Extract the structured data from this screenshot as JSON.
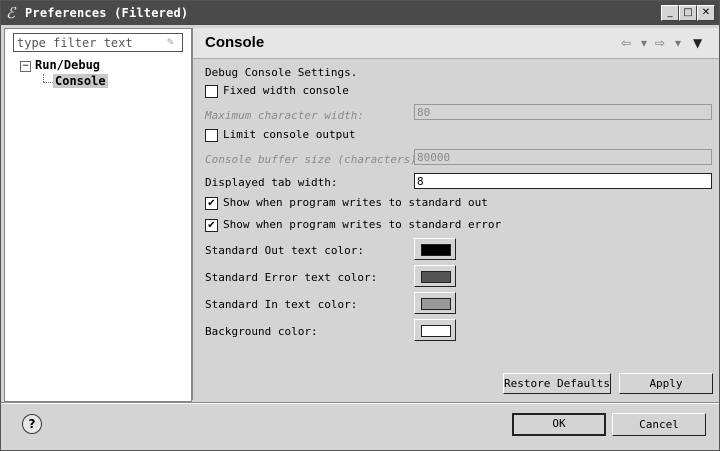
{
  "window": {
    "title": "Preferences (Filtered)",
    "app_icon": "eclipse-icon",
    "minimize": "_",
    "maximize": "□",
    "close": "✕"
  },
  "sidebar": {
    "filter_placeholder": "type filter text",
    "tree": [
      {
        "label": "Run/Debug",
        "expanded": true,
        "toggle": "−"
      },
      {
        "label": "Console",
        "selected": true
      }
    ]
  },
  "page": {
    "title": "Console",
    "nav": {
      "back": "⇦",
      "forward": "⇨",
      "dropdown": "▾",
      "menu": "▼"
    },
    "intro": "Debug Console Settings.",
    "fixed_width": {
      "label": "Fixed width console",
      "checked": false
    },
    "max_char_width": {
      "label": "Maximum character width:",
      "value": "80",
      "enabled": false
    },
    "limit_output": {
      "label": "Limit console output",
      "checked": false
    },
    "buffer_size": {
      "label": "Console buffer size (characters):",
      "value": "80000",
      "enabled": false
    },
    "tab_width": {
      "label": "Displayed tab width:",
      "value": "8"
    },
    "show_stdout": {
      "label": "Show when program writes to standard out",
      "checked": true
    },
    "show_stderr": {
      "label": "Show when program writes to standard error",
      "checked": true
    },
    "colors": [
      {
        "label": "Standard Out text color:",
        "color": "#000000"
      },
      {
        "label": "Standard Error text color:",
        "color": "#555555"
      },
      {
        "label": "Standard In text color:",
        "color": "#999999"
      },
      {
        "label": "Background color:",
        "color": "#ffffff"
      }
    ],
    "restore_defaults": "Restore Defaults",
    "apply": "Apply"
  },
  "footer": {
    "help": "?",
    "ok": "OK",
    "cancel": "Cancel"
  }
}
